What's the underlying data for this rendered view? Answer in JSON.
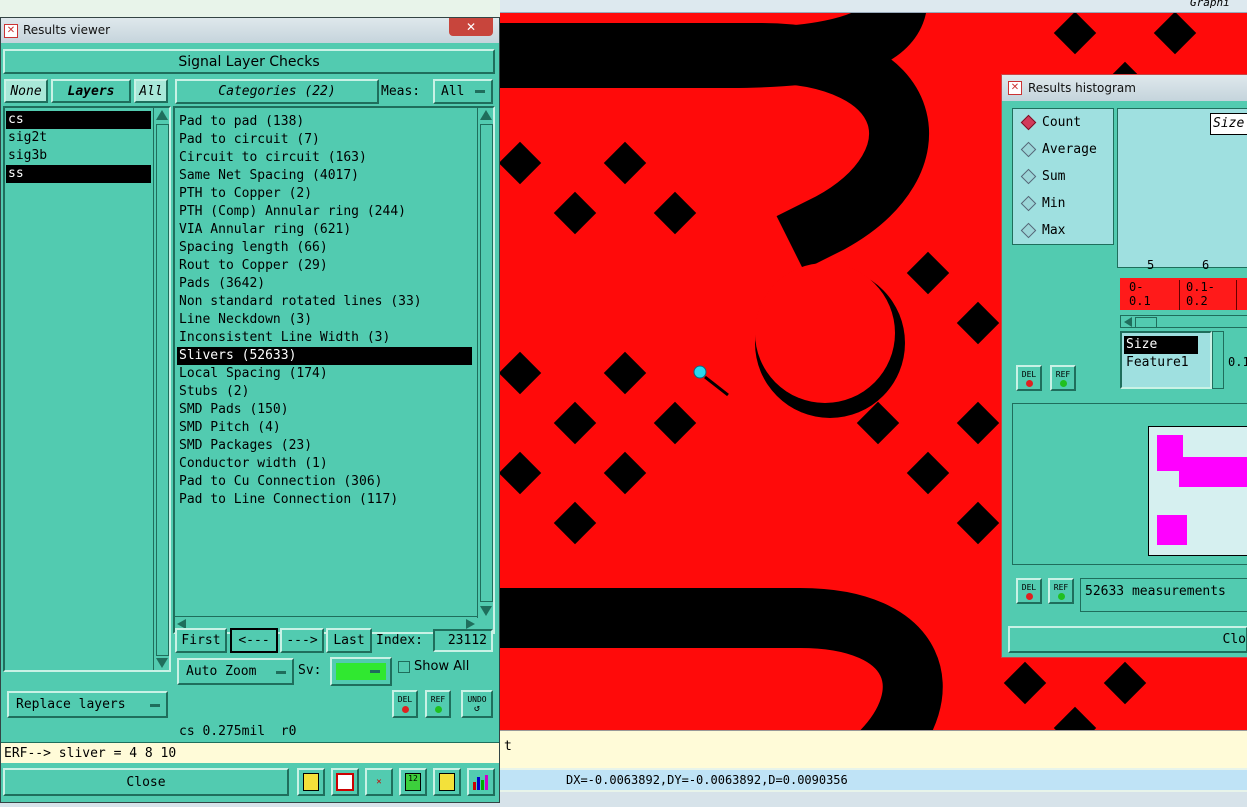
{
  "background": {
    "top_label": "Graphi",
    "status_text": "t",
    "coords": "DX=-0.0063892,DY=-0.0063892,D=0.0090356"
  },
  "results_viewer": {
    "title": "Results viewer",
    "close_x": "✕",
    "header": "Signal Layer Checks",
    "layer_buttons": {
      "none": "None",
      "layers": "Layers",
      "all": "All"
    },
    "layers": [
      {
        "label": "cs",
        "selected": true
      },
      {
        "label": "sig2t",
        "selected": false
      },
      {
        "label": "sig3b",
        "selected": false
      },
      {
        "label": "ss",
        "selected": true
      }
    ],
    "categories_label": "Categories (22)",
    "meas_label": "Meas:",
    "meas_value": "All",
    "categories": [
      {
        "label": "Pad to pad (138)",
        "selected": false
      },
      {
        "label": "Pad to circuit (7)",
        "selected": false
      },
      {
        "label": "Circuit to circuit (163)",
        "selected": false
      },
      {
        "label": "Same Net Spacing (4017)",
        "selected": false
      },
      {
        "label": "PTH to Copper (2)",
        "selected": false
      },
      {
        "label": "PTH (Comp) Annular ring (244)",
        "selected": false
      },
      {
        "label": "VIA Annular ring (621)",
        "selected": false
      },
      {
        "label": "Spacing length (66)",
        "selected": false
      },
      {
        "label": "Rout to Copper (29)",
        "selected": false
      },
      {
        "label": "Pads (3642)",
        "selected": false
      },
      {
        "label": "Non standard rotated lines (33)",
        "selected": false
      },
      {
        "label": "Line Neckdown (3)",
        "selected": false
      },
      {
        "label": "Inconsistent Line Width (3)",
        "selected": false
      },
      {
        "label": "Slivers (52633)",
        "selected": true
      },
      {
        "label": "Local Spacing (174)",
        "selected": false
      },
      {
        "label": "Stubs (2)",
        "selected": false
      },
      {
        "label": "SMD Pads (150)",
        "selected": false
      },
      {
        "label": "SMD Pitch (4)",
        "selected": false
      },
      {
        "label": "SMD Packages (23)",
        "selected": false
      },
      {
        "label": "Conductor width (1)",
        "selected": false
      },
      {
        "label": "Pad to Cu Connection (306)",
        "selected": false
      },
      {
        "label": "Pad to Line Connection (117)",
        "selected": false
      }
    ],
    "nav": {
      "first": "First",
      "prev": "<---",
      "next": "--->",
      "last": "Last",
      "index_label": "Index:",
      "index_value": "23112"
    },
    "auto_zoom": "Auto Zoom",
    "sv_label": "Sv:",
    "show_all": "Show All",
    "replace_layers": "Replace layers",
    "del": "DEL",
    "ref": "REF",
    "undo": "UNDO",
    "info": "cs 0.275mil  r0",
    "erf": "ERF--> sliver = 4 8 10",
    "close": "Close"
  },
  "histogram": {
    "title": "Results histogram",
    "options": [
      {
        "label": "Count",
        "selected": true
      },
      {
        "label": "Average",
        "selected": false
      },
      {
        "label": "Sum",
        "selected": false
      },
      {
        "label": "Min",
        "selected": false
      },
      {
        "label": "Max",
        "selected": false
      }
    ],
    "size_label": "Size",
    "bars": [
      {
        "count": "5",
        "range": "0-\n0.1"
      },
      {
        "count": "6",
        "range": "0.1-\n0.2"
      }
    ],
    "fields": [
      "Size",
      "Feature1"
    ],
    "partial_value": "0.1",
    "del": "DEL",
    "ref": "REF",
    "measurements": "52633 measurements",
    "close": "Clo"
  },
  "colors": {
    "teal": "#52cbb0",
    "copper_red": "#ff0a0a",
    "black": "#000000",
    "magenta": "#ff00ff",
    "cyan_marker": "#28d8f0",
    "yellow_msg": "#fffbd8"
  }
}
